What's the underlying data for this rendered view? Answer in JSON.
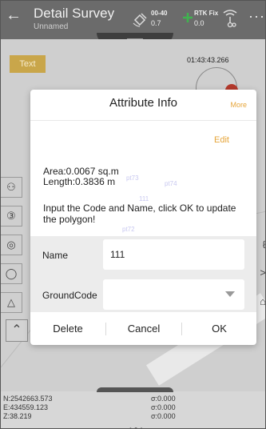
{
  "header": {
    "title": "Detail Survey",
    "subtitle": "Unnamed",
    "satellite_count": "00-40",
    "satellite_value": "0.7",
    "rtk_status": "RTK Fix",
    "rtk_value": "0.0"
  },
  "map": {
    "text_button": "Text",
    "time": "01:43:43.266",
    "point_labels": [
      "pt73",
      "pt74",
      "pt72",
      "111"
    ]
  },
  "dialog": {
    "title": "Attribute Info",
    "more_label": "More",
    "edit_label": "Edit",
    "area": "Area:0.0067 sq.m",
    "length": "Length:0.3836 m",
    "message": "Input the Code and Name, click OK to update the polygon!",
    "name_label": "Name",
    "name_value": "111",
    "groundcode_label": "GroundCode",
    "groundcode_value": "",
    "delete_label": "Delete",
    "cancel_label": "Cancel",
    "ok_label": "OK"
  },
  "coordinates": {
    "n": "N:2542663.573",
    "e": "E:434559.123",
    "z": "Z:38.219",
    "sigma_n": "σ:0.000",
    "sigma_e": "σ:0.000",
    "sigma_z": "σ:0.000"
  },
  "colors": {
    "accent": "#e6a53a",
    "toolbar": "#6b6b6b",
    "button_gold": "#c9a64a"
  }
}
